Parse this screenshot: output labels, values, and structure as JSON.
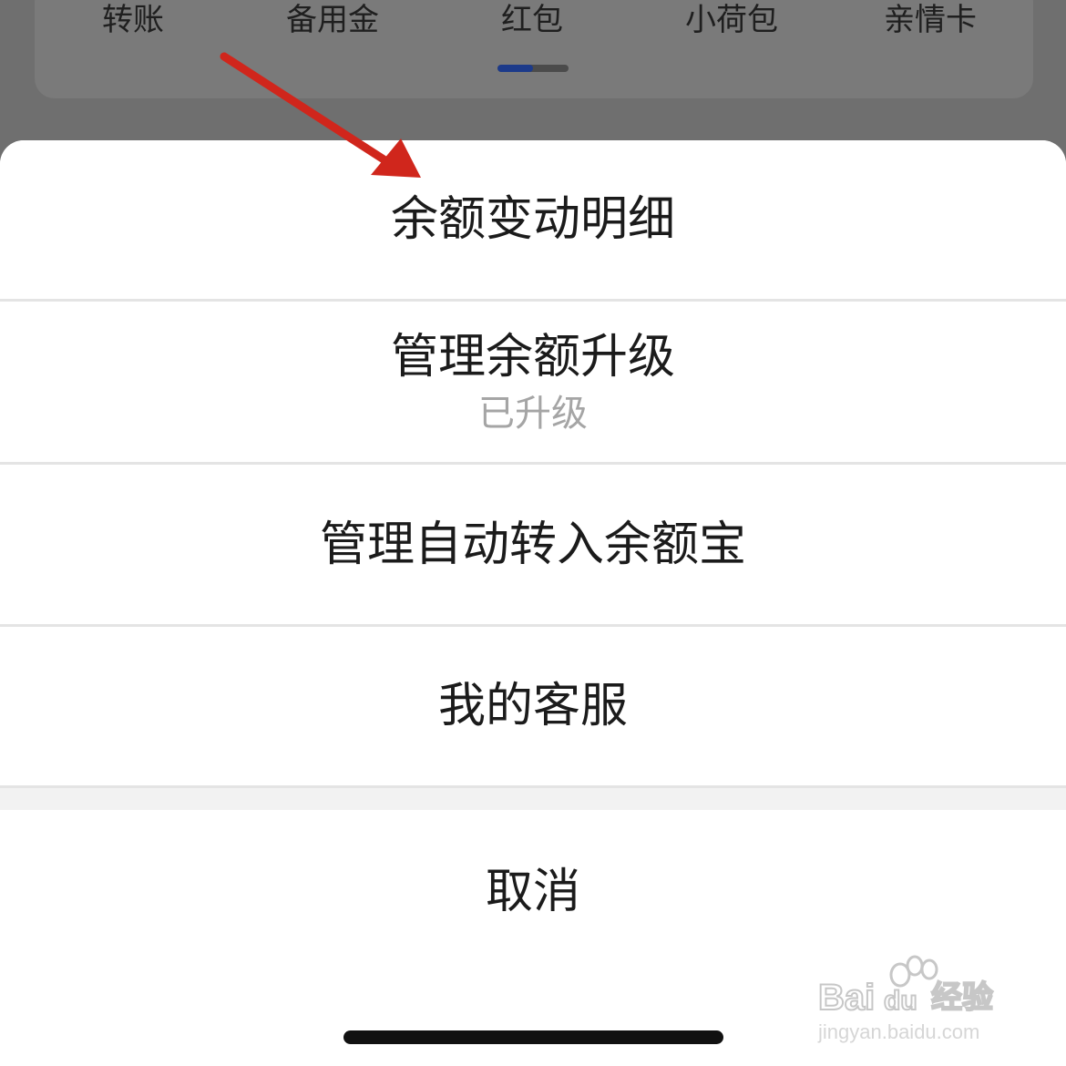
{
  "background": {
    "quick_tabs": [
      {
        "label": "转账"
      },
      {
        "label": "备用金"
      },
      {
        "label": "红包"
      },
      {
        "label": "小荷包"
      },
      {
        "label": "亲情卡"
      }
    ],
    "tab_indicator_progress": 0.5
  },
  "action_sheet": {
    "items": [
      {
        "label": "余额变动明细"
      },
      {
        "label": "管理余额升级",
        "sub": "已升级"
      },
      {
        "label": "管理自动转入余额宝"
      },
      {
        "label": "我的客服"
      }
    ],
    "cancel_label": "取消"
  },
  "annotation": {
    "arrow_color": "#d0261c"
  },
  "watermark": {
    "logo_text": "Baidu经验",
    "url": "jingyan.baidu.com"
  },
  "colors": {
    "overlay": "#6f6f6f",
    "sheet_bg": "#ffffff",
    "divider": "#e4e4e4",
    "gap": "#f2f2f2",
    "primary_text": "#1b1b1b",
    "secondary_text": "#a5a5a5",
    "indicator_active": "#1c3a8a"
  }
}
